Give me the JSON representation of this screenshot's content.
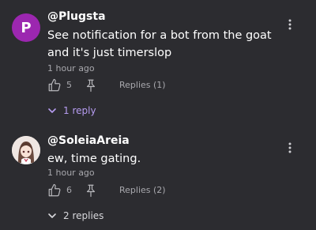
{
  "comments": [
    {
      "avatar_letter": "P",
      "avatar_color": "#9c27b0",
      "username": "@Plugsta",
      "text": "See notification for a bot from the goat and it's just timerslop",
      "time": "1 hour ago",
      "likes": "5",
      "replies_label": "Replies (1)",
      "toggle_label": "1 reply",
      "toggle_color": "#b69cf0"
    },
    {
      "avatar_icon": "anime-girl-avatar-icon",
      "username": "@SoleiaAreia",
      "text": "ew, time gating.",
      "time": "1 hour ago",
      "likes": "6",
      "replies_label": "Replies (2)",
      "toggle_label": "2 replies",
      "toggle_color": "#d8d8dc"
    }
  ]
}
